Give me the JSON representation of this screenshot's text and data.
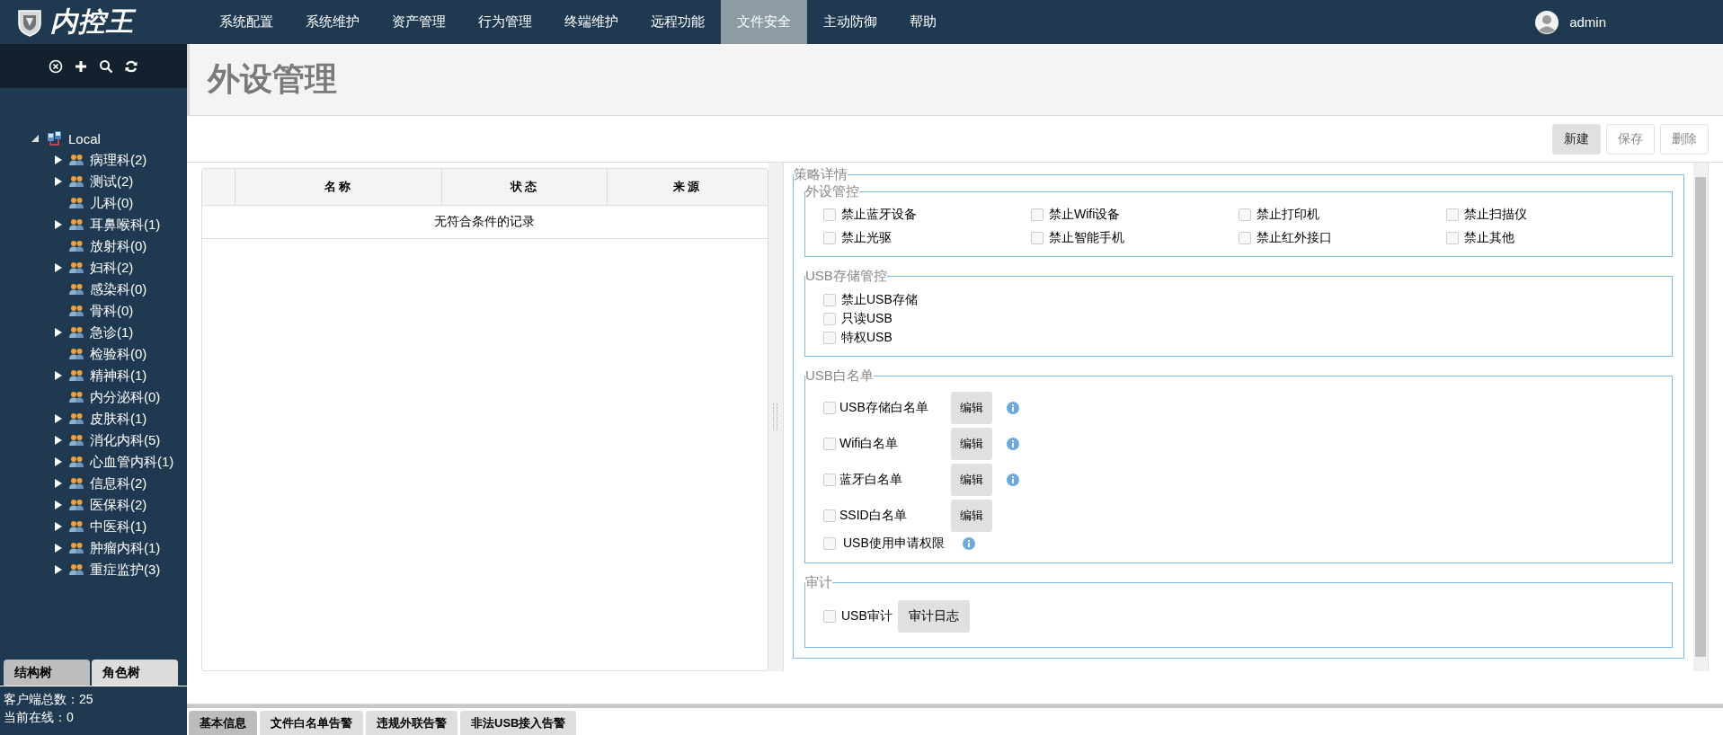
{
  "nav": {
    "logo": "内控王",
    "items": [
      {
        "label": "系统配置",
        "selected": false
      },
      {
        "label": "系统维护",
        "selected": false
      },
      {
        "label": "资产管理",
        "selected": false
      },
      {
        "label": "行为管理",
        "selected": false
      },
      {
        "label": "终端维护",
        "selected": false
      },
      {
        "label": "远程功能",
        "selected": false
      },
      {
        "label": "文件安全",
        "selected": true
      },
      {
        "label": "主动防御",
        "selected": false
      },
      {
        "label": "帮助",
        "selected": false
      }
    ],
    "user": "admin"
  },
  "sidebar": {
    "tree": {
      "label": "Local",
      "expanded": true,
      "children": [
        {
          "label": "病理科(2)",
          "kind": "branch"
        },
        {
          "label": "测试(2)",
          "kind": "branch"
        },
        {
          "label": "儿科(0)",
          "kind": "leaf"
        },
        {
          "label": "耳鼻喉科(1)",
          "kind": "branch"
        },
        {
          "label": "放射科(0)",
          "kind": "leaf"
        },
        {
          "label": "妇科(2)",
          "kind": "branch"
        },
        {
          "label": "感染科(0)",
          "kind": "leaf"
        },
        {
          "label": "骨科(0)",
          "kind": "leaf"
        },
        {
          "label": "急诊(1)",
          "kind": "branch"
        },
        {
          "label": "检验科(0)",
          "kind": "leaf"
        },
        {
          "label": "精神科(1)",
          "kind": "branch"
        },
        {
          "label": "内分泌科(0)",
          "kind": "leaf"
        },
        {
          "label": "皮肤科(1)",
          "kind": "branch"
        },
        {
          "label": "消化内科(5)",
          "kind": "branch"
        },
        {
          "label": "心血管内科(1)",
          "kind": "branch"
        },
        {
          "label": "信息科(2)",
          "kind": "branch"
        },
        {
          "label": "医保科(2)",
          "kind": "branch"
        },
        {
          "label": "中医科(1)",
          "kind": "branch"
        },
        {
          "label": "肿瘤内科(1)",
          "kind": "branch"
        },
        {
          "label": "重症监护(3)",
          "kind": "branch"
        }
      ]
    },
    "tabs": [
      {
        "label": "结构树",
        "selected": true
      },
      {
        "label": "角色树",
        "selected": false
      }
    ],
    "stats": [
      "客户端总数：25",
      "当前在线：0"
    ]
  },
  "page_title": "外设管理",
  "toolbar": [
    {
      "label": "新建",
      "disabled": false
    },
    {
      "label": "保存",
      "disabled": true
    },
    {
      "label": "删除",
      "disabled": true
    }
  ],
  "table": {
    "columns": [
      "名称",
      "状态",
      "来源"
    ],
    "empty_message": "无符合条件的记录"
  },
  "policy": {
    "title": "策略详情",
    "sections": [
      {
        "title": "外设管控",
        "kind": "grid",
        "items": [
          {
            "label": "禁止蓝牙设备",
            "checked": false
          },
          {
            "label": "禁止Wifi设备",
            "checked": false
          },
          {
            "label": "禁止打印机",
            "checked": false
          },
          {
            "label": "禁止扫描仪",
            "checked": false
          },
          {
            "label": "禁止光驱",
            "checked": false
          },
          {
            "label": "禁止智能手机",
            "checked": false
          },
          {
            "label": "禁止红外接口",
            "checked": false
          },
          {
            "label": "禁止其他",
            "checked": false
          }
        ]
      },
      {
        "title": "USB存储管控",
        "kind": "list",
        "items": [
          {
            "label": "禁止USB存储",
            "checked": false
          },
          {
            "label": "只读USB",
            "checked": false
          },
          {
            "label": "特权USB",
            "checked": false
          }
        ]
      },
      {
        "title": "USB白名单",
        "kind": "whitelist",
        "items": [
          {
            "label": "USB存储白名单",
            "checked": false,
            "button": "编辑",
            "info": true
          },
          {
            "label": "Wifi白名单",
            "checked": false,
            "button": "编辑",
            "info": true
          },
          {
            "label": "蓝牙白名单",
            "checked": false,
            "button": "编辑",
            "info": true
          },
          {
            "label": "SSID白名单",
            "checked": false,
            "button": "编辑",
            "info": false
          },
          {
            "label": "USB使用申请权限",
            "checked": false,
            "info": true
          }
        ]
      },
      {
        "title": "审计",
        "kind": "audit",
        "items": [
          {
            "label": "USB审计",
            "checked": false,
            "button": "审计日志"
          }
        ]
      }
    ]
  },
  "bottom_tabs": [
    {
      "label": "基本信息",
      "selected": true
    },
    {
      "label": "文件白名单告警",
      "selected": false
    },
    {
      "label": "违规外联告警",
      "selected": false
    },
    {
      "label": "非法USB接入告警",
      "selected": false
    }
  ]
}
